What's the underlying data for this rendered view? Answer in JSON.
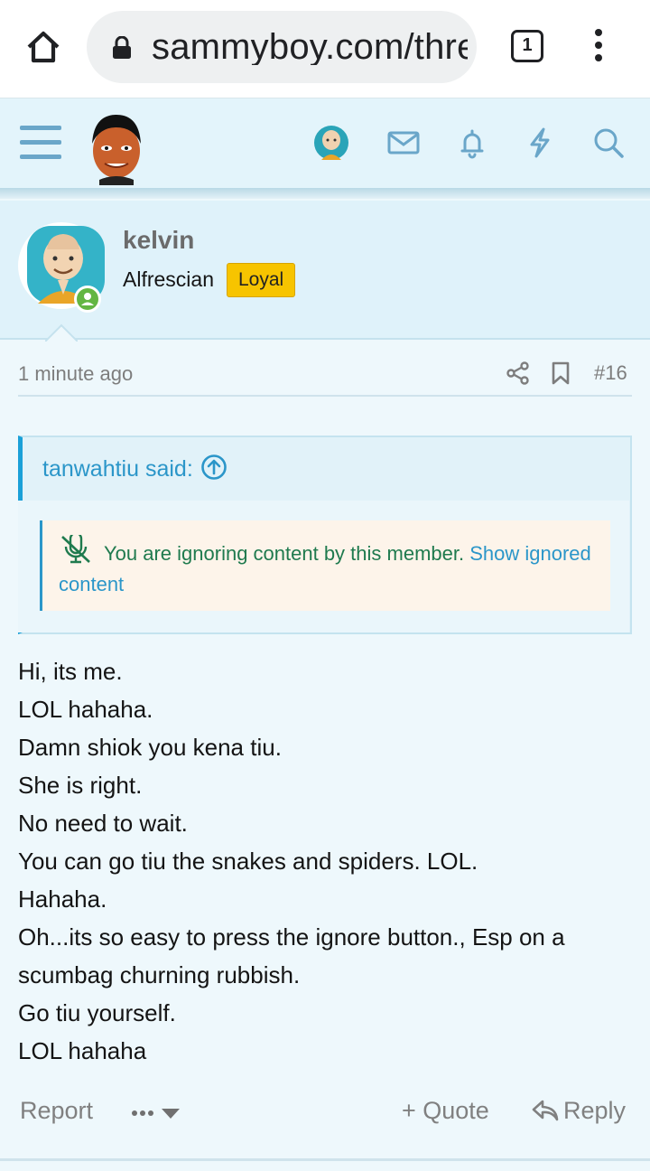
{
  "browser": {
    "url": "sammyboy.com/threads/",
    "tab_count": "1",
    "icons": {
      "home": "home-icon",
      "lock": "lock-icon",
      "menu": "kebab-menu-icon"
    }
  },
  "site_header": {
    "icons": [
      "menu-icon",
      "site-logo",
      "user-avatar",
      "mail-icon",
      "bell-icon",
      "bolt-icon",
      "search-icon"
    ],
    "accent": "#6aa6c9"
  },
  "post": {
    "username": "kelvin",
    "user_title": "Alfrescian",
    "badge": "Loyal",
    "badge_color": "#f7c400",
    "online": true,
    "time": "1 minute ago",
    "post_number": "#16",
    "quote": {
      "author_label": "tanwahtiu said:",
      "ignored_text": "You are ignoring content by this member.",
      "show_ignored_label": "Show ignored content"
    },
    "lines": [
      "Hi, its me.",
      "LOL hahaha.",
      "Damn shiok you kena tiu.",
      "She is right.",
      "No need to wait.",
      "You can go tiu the snakes and spiders. LOL.",
      "Hahaha.",
      "Oh...its so easy to press the ignore button., Esp on a scumbag churning rubbish.",
      "Go tiu yourself.",
      "LOL hahaha"
    ],
    "actions": {
      "report": "Report",
      "quote": "+ Quote",
      "reply": "Reply"
    }
  }
}
